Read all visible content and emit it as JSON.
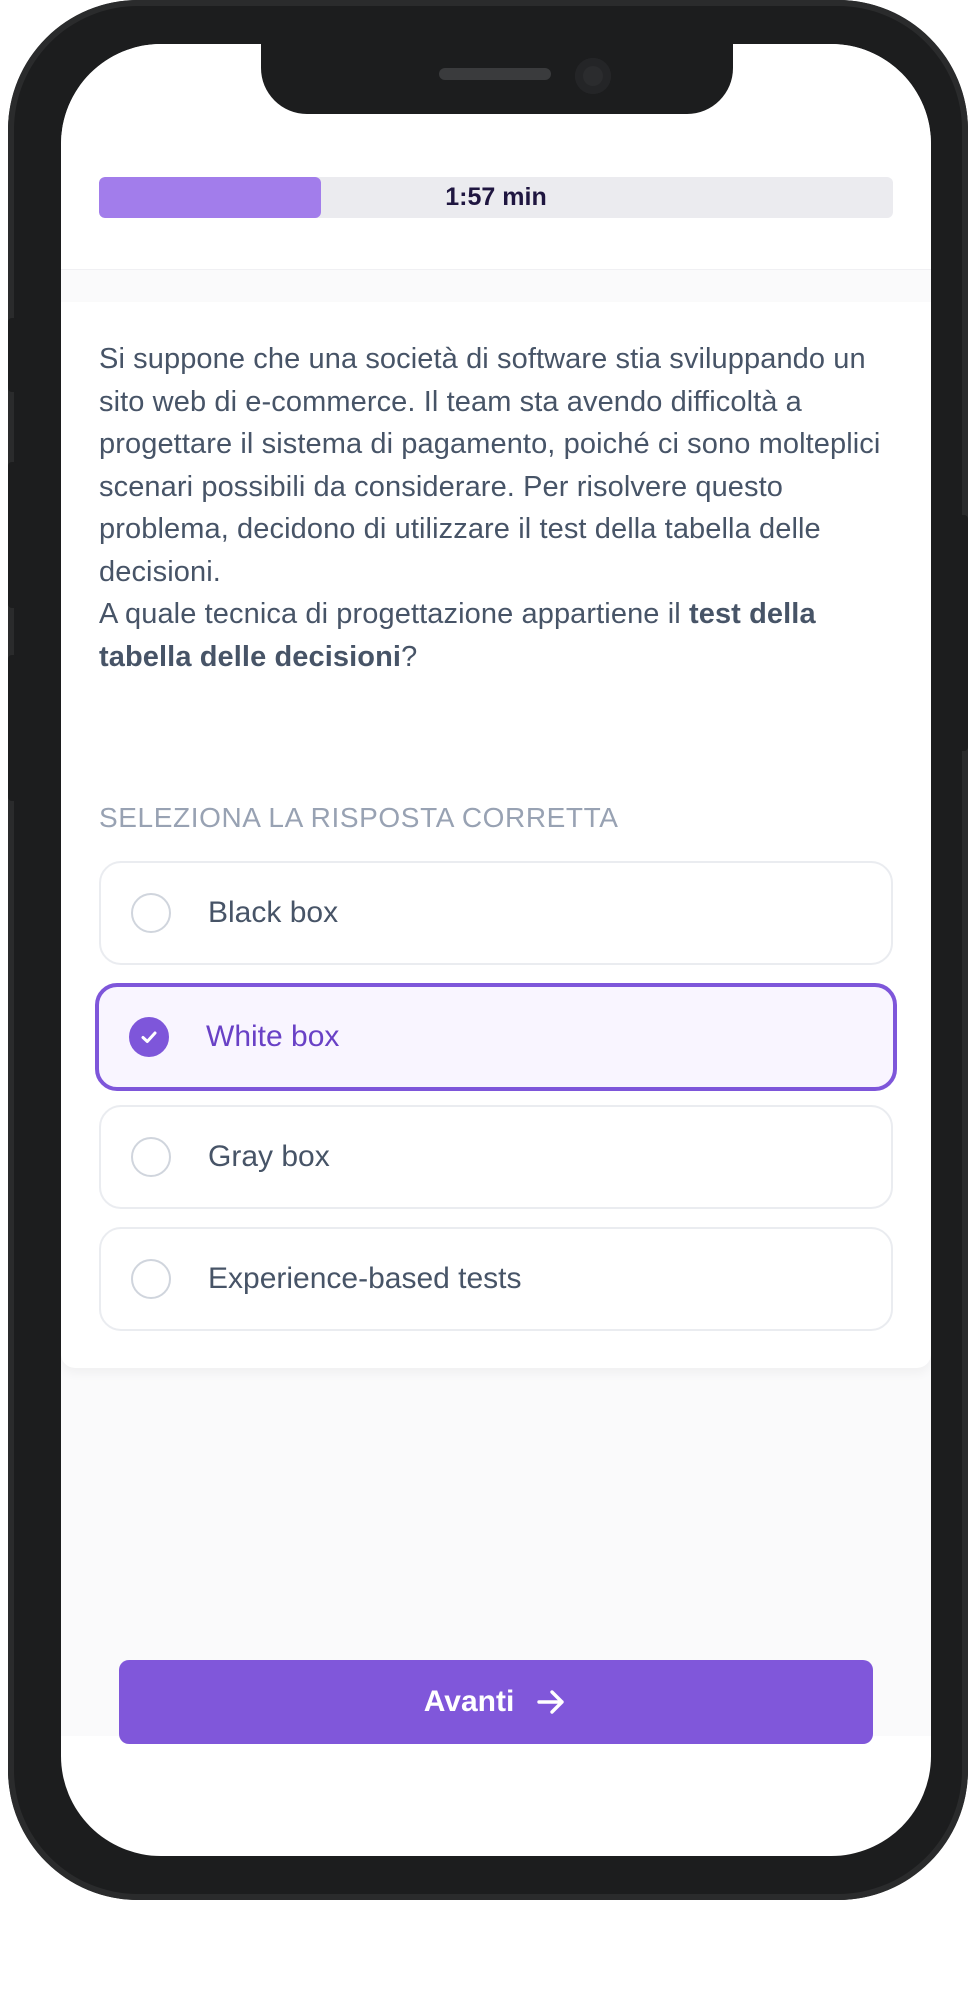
{
  "timer": {
    "label": "1:57 min",
    "progress_fraction": 0.28
  },
  "question": {
    "text_plain": "Si suppone che una società di software stia sviluppando un sito web di e-commerce. Il team sta avendo difficoltà a progettare il sistema di pagamento, poiché ci sono molteplici scenari possibili da considerare. Per risolvere questo problema, decidono di utilizzare il test della tabella delle decisioni.",
    "prompt_prefix": "A quale tecnica di progettazione appartiene il ",
    "prompt_bold": "test della tabella delle decisioni",
    "prompt_suffix": "?"
  },
  "select_label": "SELEZIONA LA RISPOSTA CORRETTA",
  "options": [
    {
      "label": "Black box",
      "selected": false
    },
    {
      "label": "White box",
      "selected": true
    },
    {
      "label": "Gray box",
      "selected": false
    },
    {
      "label": "Experience-based tests",
      "selected": false
    }
  ],
  "next_button": {
    "label": "Avanti",
    "icon": "arrow-right-icon"
  },
  "colors": {
    "accent": "#8057da",
    "accent_light": "#a27deb",
    "selected_bg": "#f9f5ff",
    "text": "#475467",
    "muted": "#98a2b3"
  }
}
